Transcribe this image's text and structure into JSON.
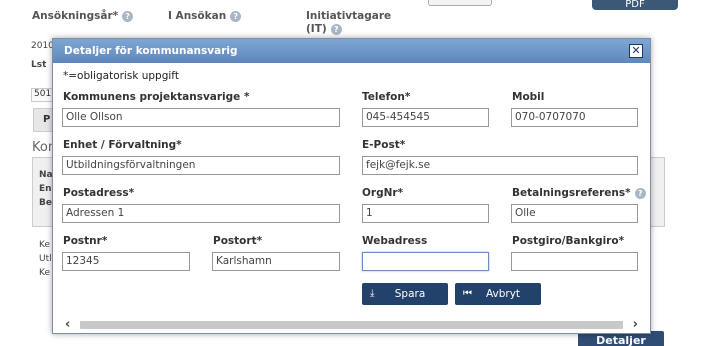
{
  "background": {
    "labels": {
      "ansokningsar": "Ansökningsår*",
      "i_ansokan": "I Ansökan",
      "initiativtagare_line1": "Initiativtagare",
      "initiativtagare_line2": "(IT)"
    },
    "pdf_label": "PDF",
    "snippets": {
      "year": "2010",
      "lst": "Lst",
      "num": "501",
      "tab": "P",
      "kom": "Kom",
      "na": "Na",
      "en": "En",
      "be": "Be",
      "ke1": "Ke",
      "utl": "Utl",
      "ke2": "Ke"
    },
    "detaljer_button": "Detaljer"
  },
  "modal": {
    "title": "Detaljer för kommunansvarig",
    "close_symbol": "✕",
    "required_note": "*=obligatorisk uppgift",
    "fields": {
      "projektansvarig": {
        "label": "Kommunens projektansvarige *",
        "value": "Olle Ollson"
      },
      "telefon": {
        "label": "Telefon*",
        "value": "045-454545"
      },
      "mobil": {
        "label": "Mobil",
        "value": "070-0707070"
      },
      "enhet": {
        "label": "Enhet / Förvaltning*",
        "value": "Utbildningsförvaltningen"
      },
      "epost": {
        "label": "E-Post*",
        "value": "fejk@fejk.se"
      },
      "postadress": {
        "label": "Postadress*",
        "value": "Adressen 1"
      },
      "orgnr": {
        "label": "OrgNr*",
        "value": "1"
      },
      "betalningsreferens": {
        "label": "Betalningsreferens*",
        "value": "Olle"
      },
      "postnr": {
        "label": "Postnr*",
        "value": "12345"
      },
      "postort": {
        "label": "Postort*",
        "value": "Karlshamn"
      },
      "webadress": {
        "label": "Webadress",
        "value": ""
      },
      "postgiro": {
        "label": "Postgiro/Bankgiro*",
        "value": ""
      }
    },
    "buttons": {
      "spara": "Spara",
      "avbryt": "Avbryt"
    },
    "colors": {
      "header": "#6b93c6",
      "button": "#23426b"
    }
  }
}
